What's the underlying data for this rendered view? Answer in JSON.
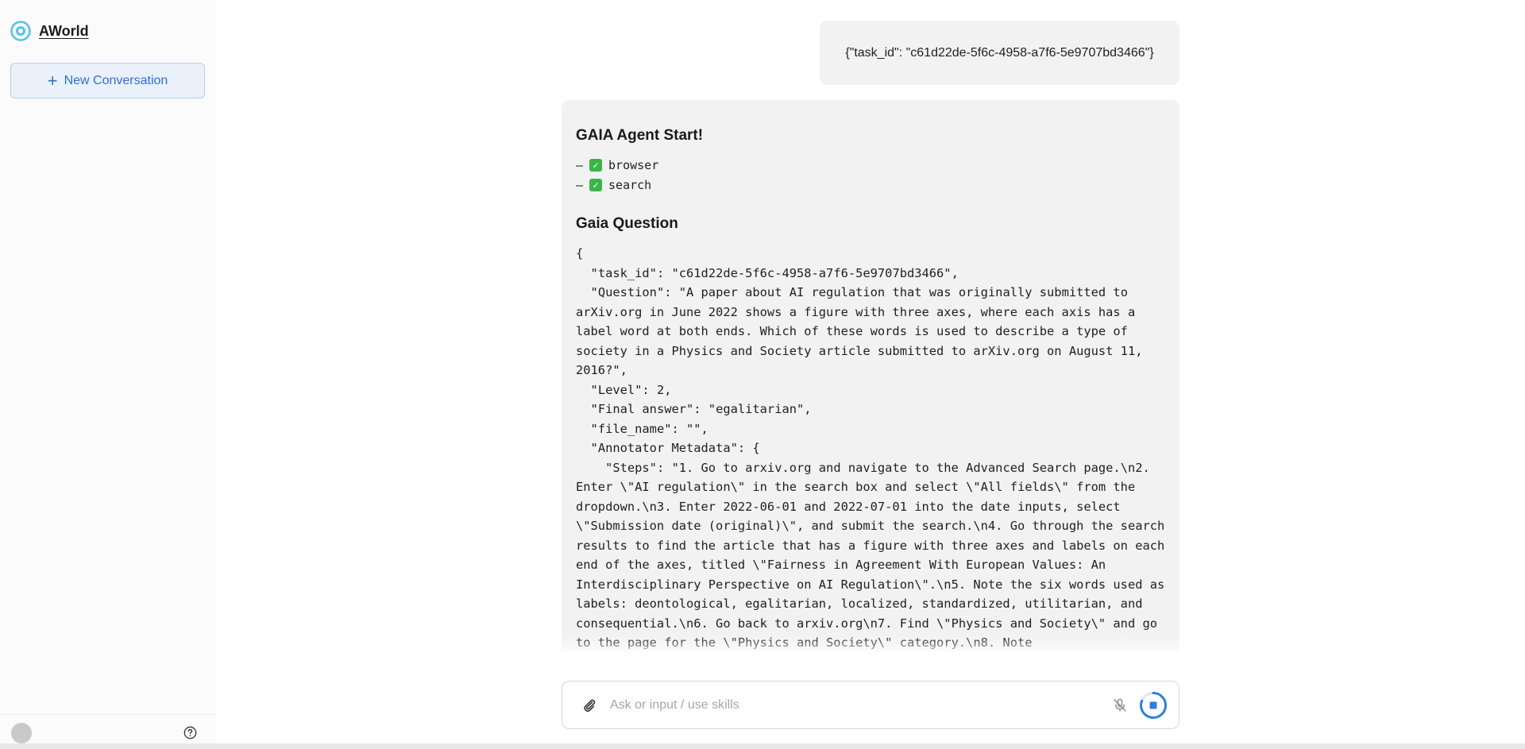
{
  "brand": {
    "name": "AWorld"
  },
  "sidebar": {
    "new_conversation_label": "New Conversation"
  },
  "messages": {
    "user": "{\"task_id\": \"c61d22de-5f6c-4958-a7f6-5e9707bd3466\"}",
    "agent": {
      "title": "GAIA Agent Start!",
      "tools": [
        "browser",
        "search"
      ],
      "question_title": "Gaia Question",
      "question_json": "{\n  \"task_id\": \"c61d22de-5f6c-4958-a7f6-5e9707bd3466\",\n  \"Question\": \"A paper about AI regulation that was originally submitted to arXiv.org in June 2022 shows a figure with three axes, where each axis has a label word at both ends. Which of these words is used to describe a type of society in a Physics and Society article submitted to arXiv.org on August 11, 2016?\",\n  \"Level\": 2,\n  \"Final answer\": \"egalitarian\",\n  \"file_name\": \"\",\n  \"Annotator Metadata\": {\n    \"Steps\": \"1. Go to arxiv.org and navigate to the Advanced Search page.\\n2. Enter \\\"AI regulation\\\" in the search box and select \\\"All fields\\\" from the dropdown.\\n3. Enter 2022-06-01 and 2022-07-01 into the date inputs, select \\\"Submission date (original)\\\", and submit the search.\\n4. Go through the search results to find the article that has a figure with three axes and labels on each end of the axes, titled \\\"Fairness in Agreement With European Values: An Interdisciplinary Perspective on AI Regulation\\\".\\n5. Note the six words used as labels: deontological, egalitarian, localized, standardized, utilitarian, and consequential.\\n6. Go back to arxiv.org\\n7. Find \\\"Physics and Society\\\" and go to the page for the \\\"Physics and Society\\\" category.\\n8. Note"
    }
  },
  "input": {
    "placeholder": "Ask or input / use skills"
  },
  "colors": {
    "accent": "#2f6fd0",
    "check": "#3bb54a",
    "bubble": "#f2f2f2"
  },
  "icons": {
    "logo": "aworld-logo-icon",
    "plus": "plus-icon",
    "help": "help-icon",
    "attach": "paperclip-icon",
    "mic": "mic-off-icon",
    "stop": "stop-icon",
    "check": "check-icon"
  }
}
